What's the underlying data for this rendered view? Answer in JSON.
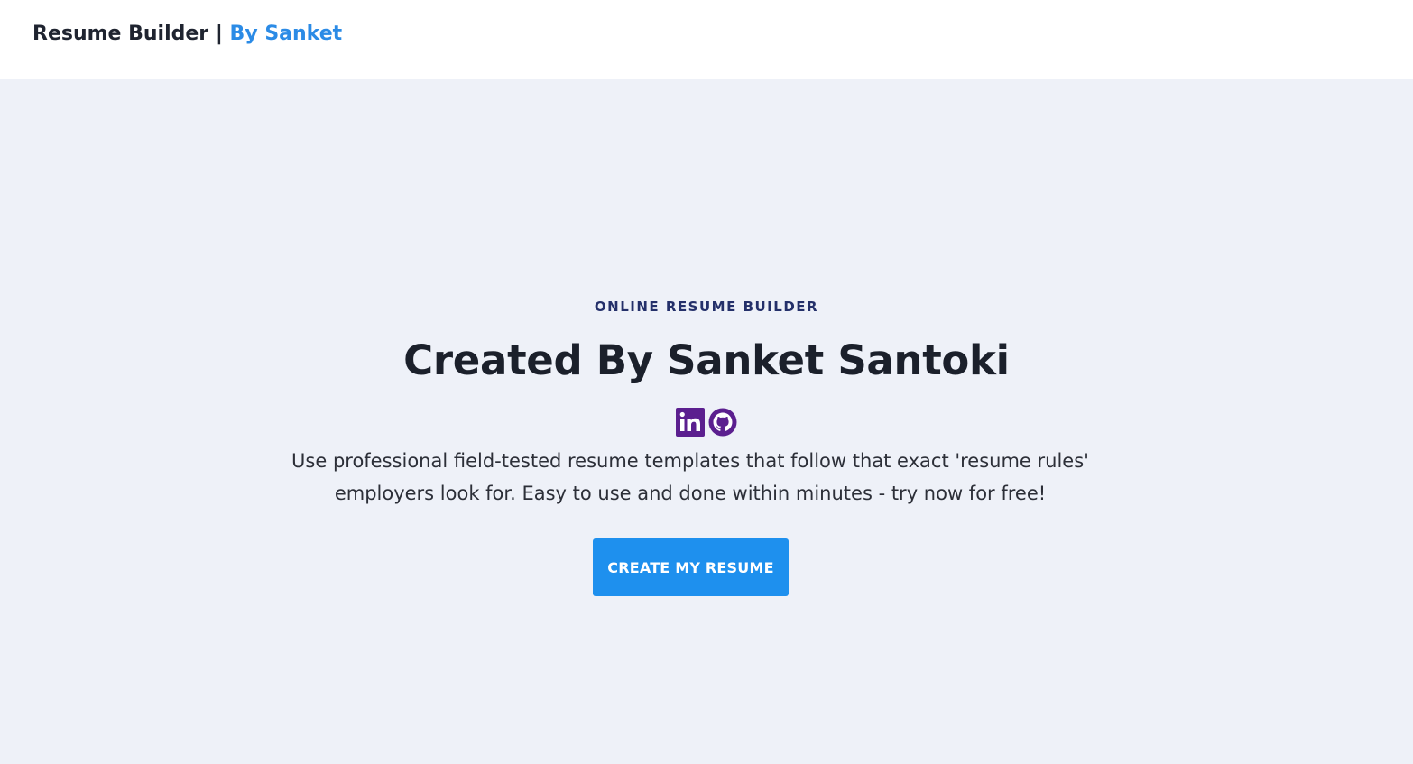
{
  "header": {
    "brand_title": "Resume Builder",
    "separator": "|",
    "brand_author": "By Sanket"
  },
  "hero": {
    "eyebrow": "ONLINE RESUME BUILDER",
    "headline": "Created By Sanket Santoki",
    "social": [
      {
        "icon": "linkedin-icon"
      },
      {
        "icon": "github-icon"
      }
    ],
    "description": "Use professional field-tested resume templates that follow that exact 'resume rules' employers look for. Easy to use and done within minutes - try now for free!",
    "cta_label": "CREATE MY RESUME"
  },
  "colors": {
    "page_background": "#eef1f8",
    "header_background": "#ffffff",
    "accent": "#2b8be6",
    "button": "#1e90ee",
    "social_icons": "#5b1f8f",
    "eyebrow": "#24306a",
    "headline": "#1b202b"
  }
}
